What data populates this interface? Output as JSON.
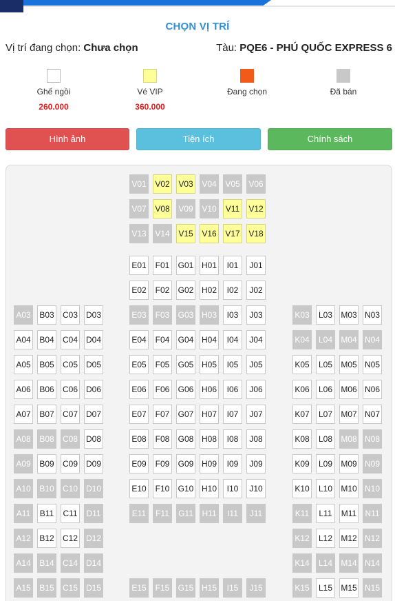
{
  "header": {
    "title": "CHỌN VỊ TRÍ",
    "position_label": "Vị trí đang chọn:",
    "position_value": "Chưa chọn",
    "train_label": "Tàu:",
    "train_value": "PQE6 - PHÚ QUỐC EXPRESS 6"
  },
  "legend": [
    {
      "label": "Ghế ngồi",
      "price": "260.000",
      "color": "#ffffff"
    },
    {
      "label": "Vé VIP",
      "price": "360.000",
      "color": "#ffff99"
    },
    {
      "label": "Đang chọn",
      "price": "",
      "color": "#f25a1a"
    },
    {
      "label": "Đã bán",
      "price": "",
      "color": "#c8c8c8"
    }
  ],
  "buttons": [
    {
      "label": "Hình ảnh",
      "color": "#e05252"
    },
    {
      "label": "Tiện ích",
      "color": "#5bc0de"
    },
    {
      "label": "Chính sách",
      "color": "#5cb85c"
    }
  ],
  "seat_map": {
    "vip_rows": [
      [
        "V01:s",
        "V02:v",
        "V03:v",
        "V04:s",
        "V05:s",
        "V06:s"
      ],
      [
        "V07:s",
        "V08:v",
        "V09:s",
        "V10:s",
        "V11:v",
        "V12:v"
      ],
      [
        "V13:s",
        "V14:s",
        "V15:v",
        "V16:v",
        "V17:v",
        "V18:v"
      ]
    ],
    "rows": [
      {
        "left": [],
        "center": [
          "E01:a",
          "F01:a",
          "G01:a",
          "H01:a",
          "I01:a",
          "J01:a"
        ],
        "right": []
      },
      {
        "left": [],
        "center": [
          "E02:a",
          "F02:a",
          "G02:a",
          "H02:a",
          "I02:a",
          "J02:a"
        ],
        "right": []
      },
      {
        "left": [
          "A03:s",
          "B03:a",
          "C03:a",
          "D03:a"
        ],
        "center": [
          "E03:s",
          "F03:s",
          "G03:s",
          "H03:s",
          "I03:a",
          "J03:a"
        ],
        "right": [
          "K03:s",
          "L03:a",
          "M03:a",
          "N03:a"
        ]
      },
      {
        "left": [
          "A04:a",
          "B04:a",
          "C04:a",
          "D04:a"
        ],
        "center": [
          "E04:a",
          "F04:a",
          "G04:a",
          "H04:a",
          "I04:a",
          "J04:a"
        ],
        "right": [
          "K04:s",
          "L04:s",
          "M04:s",
          "N04:s"
        ]
      },
      {
        "left": [
          "A05:a",
          "B05:a",
          "C05:a",
          "D05:a"
        ],
        "center": [
          "E05:a",
          "F05:a",
          "G05:a",
          "H05:a",
          "I05:a",
          "J05:a"
        ],
        "right": [
          "K05:a",
          "L05:a",
          "M05:a",
          "N05:a"
        ]
      },
      {
        "left": [
          "A06:a",
          "B06:a",
          "C06:a",
          "D06:a"
        ],
        "center": [
          "E06:a",
          "F06:a",
          "G06:a",
          "H06:a",
          "I06:a",
          "J06:a"
        ],
        "right": [
          "K06:a",
          "L06:a",
          "M06:a",
          "N06:a"
        ]
      },
      {
        "left": [
          "A07:a",
          "B07:a",
          "C07:a",
          "D07:a"
        ],
        "center": [
          "E07:a",
          "F07:a",
          "G07:a",
          "H07:a",
          "I07:a",
          "J07:a"
        ],
        "right": [
          "K07:a",
          "L07:a",
          "M07:a",
          "N07:a"
        ]
      },
      {
        "left": [
          "A08:s",
          "B08:s",
          "C08:s",
          "D08:a"
        ],
        "center": [
          "E08:a",
          "F08:a",
          "G08:a",
          "H08:a",
          "I08:a",
          "J08:a"
        ],
        "right": [
          "K08:a",
          "L08:a",
          "M08:s",
          "N08:s"
        ]
      },
      {
        "left": [
          "A09:s",
          "B09:a",
          "C09:a",
          "D09:a"
        ],
        "center": [
          "E09:a",
          "F09:a",
          "G09:a",
          "H09:a",
          "I09:a",
          "J09:a"
        ],
        "right": [
          "K09:a",
          "L09:a",
          "M09:a",
          "N09:s"
        ]
      },
      {
        "left": [
          "A10:s",
          "B10:s",
          "C10:s",
          "D10:s"
        ],
        "center": [
          "E10:a",
          "F10:a",
          "G10:a",
          "H10:a",
          "I10:a",
          "J10:a"
        ],
        "right": [
          "K10:a",
          "L10:a",
          "M10:a",
          "N10:s"
        ]
      },
      {
        "left": [
          "A11:s",
          "B11:a",
          "C11:a",
          "D11:s"
        ],
        "center": [
          "E11:s",
          "F11:s",
          "G11:s",
          "H11:s",
          "I11:s",
          "J11:s"
        ],
        "right": [
          "K11:s",
          "L11:a",
          "M11:a",
          "N11:s"
        ]
      },
      {
        "left": [
          "A12:s",
          "B12:a",
          "C12:a",
          "D12:s"
        ],
        "center": [],
        "right": [
          "K12:s",
          "L12:a",
          "M12:a",
          "N12:s"
        ]
      },
      {
        "left": [
          "A14:s",
          "B14:s",
          "C14:s",
          "D14:s"
        ],
        "center": [],
        "right": [
          "K14:s",
          "L14:s",
          "M14:s",
          "N14:s"
        ]
      },
      {
        "left": [
          "A15:s",
          "B15:s",
          "C15:s",
          "D15:s"
        ],
        "center": [
          "E15:s",
          "F15:s",
          "G15:s",
          "H15:s",
          "I15:s",
          "J15:s"
        ],
        "right": [
          "K15:s",
          "L15:a",
          "M15:a",
          "N15:s"
        ]
      }
    ]
  }
}
